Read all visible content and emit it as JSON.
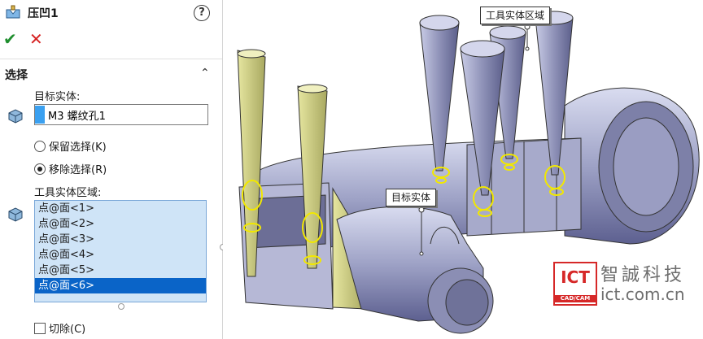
{
  "feature": {
    "title": "压凹1",
    "icon": "indent-feature-icon",
    "help_label": "?"
  },
  "actions": {
    "ok_symbol": "✔",
    "cancel_symbol": "✕"
  },
  "selection": {
    "section_title": "选择",
    "collapse_symbol": "⌃",
    "target_label": "目标实体:",
    "target_value": "M3 螺纹孔1",
    "keep_label": "保留选择(K)",
    "remove_label": "移除选择(R)",
    "selected_option": "remove",
    "tool_region_label": "工具实体区域:",
    "tool_items": [
      "点@面<1>",
      "点@面<2>",
      "点@面<3>",
      "点@面<4>",
      "点@面<5>",
      "点@面<6>"
    ],
    "selected_item_index": 5,
    "cut_label": "切除(C)",
    "cut_checked": false
  },
  "viewport": {
    "callout_tool": "工具实体区域",
    "callout_target": "目标实体"
  },
  "watermark": {
    "logo_text": "ICT",
    "logo_sub": "CAD/CAM",
    "company": "智誠科技",
    "url": "ict.com.cn"
  },
  "colors": {
    "accent_blue": "#0a64c8",
    "list_bg": "#cfe4f7",
    "ok_green": "#1f8e2e",
    "cancel_red": "#d62222",
    "model_gray": "#9a9cc0",
    "tool_yellow": "#c8c87a",
    "highlight_yellow": "#f2e800"
  }
}
